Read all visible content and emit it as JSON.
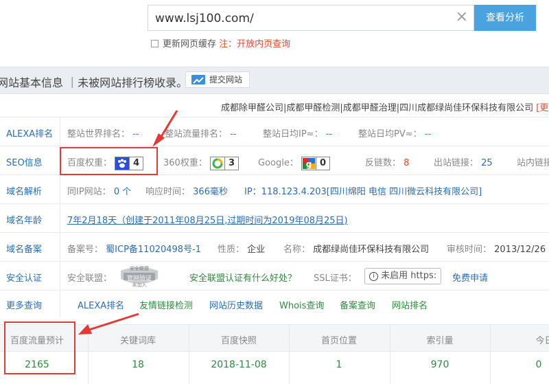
{
  "search": {
    "url_value": "www.lsj100.com/",
    "button_label": "查看分析",
    "cache_label": "更新网页缓存",
    "note_prefix": "注：",
    "note_text": "开放内页查询"
  },
  "section": {
    "title": "网站基本信息 ｜未被网站排行榜收录。",
    "submit_label": "提交网站",
    "links_text": "成都除甲醛公司|成都甲醛检测|成都甲醛治理|四川成都绿尚佳环保科技有限公司",
    "links_more": "[更"
  },
  "alexa": {
    "label": "ALEXA排名",
    "world_rank_label": "整站世界排名：",
    "world_rank_value": "--",
    "traffic_rank_label": "整站流量排名：",
    "traffic_rank_value": "--",
    "daily_ip_label": "整站日均IP≈：",
    "daily_ip_value": "--",
    "daily_pv_label": "整站日均PV≈：",
    "daily_pv_value": "--"
  },
  "seo": {
    "label": "SEO信息",
    "baidu_label": "百度权重：",
    "baidu_value": "4",
    "s360_label": "360权重：",
    "s360_value": "3",
    "google_label": "Google：",
    "google_value": "0",
    "backlinks_label": "反链数：",
    "backlinks_value": "8",
    "outlinks_label": "出站链接：",
    "outlinks_value": "25",
    "inlinks_label": "站内链接"
  },
  "dns": {
    "label": "域名解析",
    "same_ip_label": "同IP网站：",
    "same_ip_value": "0 个",
    "response_label": "响应时间：",
    "response_value": "366毫秒",
    "ip_text": "IP：118.123.4.203[四川绵阳 电信 四川微云科技有限公司]"
  },
  "age": {
    "label": "域名年龄",
    "value": "7年2月18天（创建于2011年08月25日,过期时间为2019年08月25日)"
  },
  "icp": {
    "label": "域名备案",
    "number_label": "备案号：",
    "number_value": "蜀ICP备11020498号-1",
    "nature_label": "性质：",
    "nature_value": "企业",
    "name_label": "名称：",
    "name_value": "成都绿尚佳环保科技有限公司",
    "audit_label": "审核时间：",
    "audit_value": "2013/12/26"
  },
  "security": {
    "label": "安全认证",
    "alliance_label": "安全联盟：",
    "seal_top": "安全联盟",
    "seal_text": "官网验证",
    "seal_bottom": "未加入",
    "alliance_link": "安全联盟认证有什么好处？",
    "ssl_label": "SSL证书：",
    "ssl_button": "未启用 https:",
    "free_apply": "免费申请"
  },
  "more": {
    "label": "更多查询",
    "links": [
      "ALEXA排名",
      "友情链接检测",
      "网站历史数据",
      "Whois查询",
      "备案查询",
      "网站排名"
    ]
  },
  "stats": {
    "headers": [
      "百度流量预计",
      "关键词库",
      "百度快照",
      "首页位置",
      "索引量",
      "今日收"
    ],
    "values": [
      "2165",
      "18",
      "2018-11-08",
      "1",
      "970",
      "0"
    ]
  },
  "colors": {
    "accent": "#4aa3df",
    "annotation": "#e53935",
    "green": "#2d8a3f",
    "link": "#2b6cb3"
  }
}
